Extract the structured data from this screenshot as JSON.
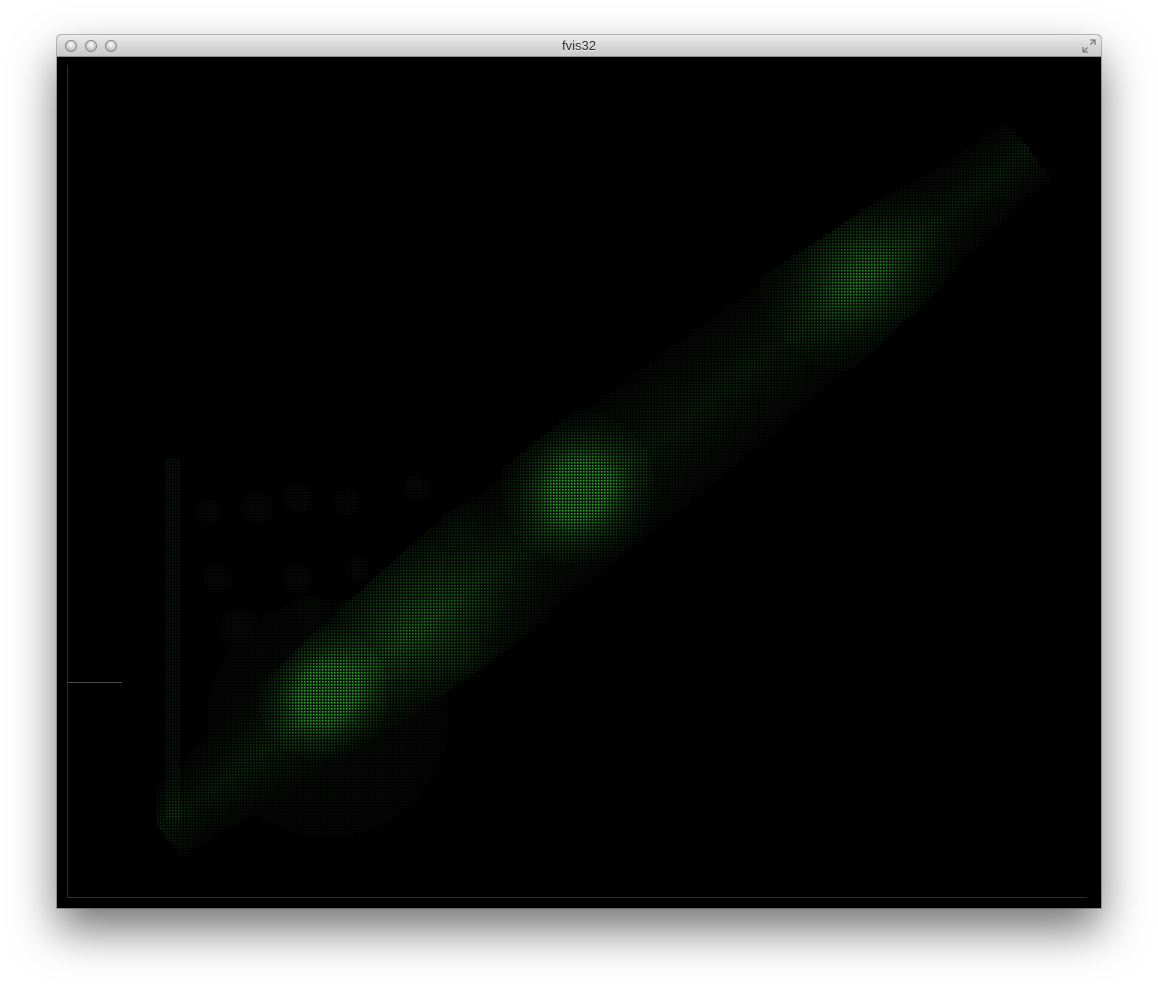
{
  "window": {
    "title": "fvis32",
    "controls": [
      "close-icon",
      "minimize-icon",
      "zoom-icon",
      "fullscreen-icon"
    ]
  },
  "chart_data": {
    "type": "heatmap",
    "title": "",
    "xlabel": "",
    "ylabel": "",
    "grid": false,
    "legend": "none",
    "colors": {
      "background": "#000000",
      "low": "#1a1a1a",
      "mid": "#3a5a3a",
      "high": "#5dff5d"
    }
  }
}
